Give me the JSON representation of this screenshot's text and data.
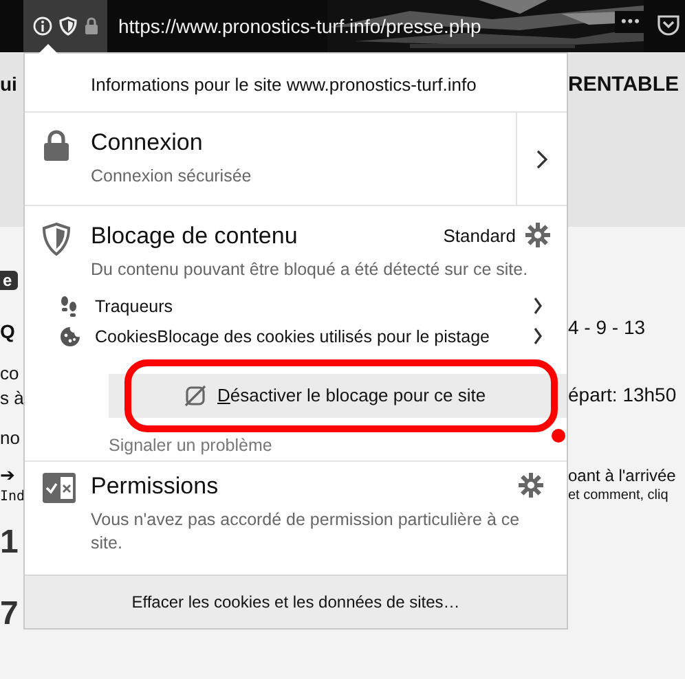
{
  "toolbar": {
    "url": "https://www.pronostics-turf.info/presse.php",
    "more_button": "•••"
  },
  "page_left": [
    {
      "kind": "bold",
      "text": "ui"
    },
    {
      "kind": "badge",
      "text": "e"
    },
    {
      "kind": "bold",
      "text": "Q"
    },
    {
      "kind": "plain",
      "text": "co"
    },
    {
      "kind": "plain",
      "text": "s à"
    },
    {
      "kind": "plain",
      "text": "no"
    },
    {
      "kind": "plain",
      "text": "➔"
    },
    {
      "kind": "small",
      "text": "Ind"
    },
    {
      "kind": "large",
      "text": "1"
    },
    {
      "kind": "large",
      "text": "7"
    }
  ],
  "page_right": [
    {
      "kind": "bold",
      "text": "RENTABLE"
    },
    {
      "kind": "plain",
      "text": "4 - 9 - 13"
    },
    {
      "kind": "plain",
      "text": "épart: 13h50"
    },
    {
      "kind": "plain",
      "text": "oant à l'arrivée"
    },
    {
      "kind": "small",
      "text": "et comment, cliq"
    }
  ],
  "panel": {
    "title": "Informations pour le site www.pronostics-turf.info",
    "connection": {
      "title": "Connexion",
      "subtitle": "Connexion sécurisée"
    },
    "content_blocking": {
      "title": "Blocage de contenu",
      "mode": "Standard",
      "description": "Du contenu pouvant être bloqué a été détecté sur ce site.",
      "items": [
        {
          "kind": "trackers",
          "label": "Traqueurs"
        },
        {
          "kind": "cookies",
          "label": "CookiesBlocage des cookies utilisés pour le pistage"
        }
      ],
      "disable_button": {
        "label": "Désactiver le blocage pour ce site"
      },
      "report_link": "Signaler un problème"
    },
    "permissions": {
      "title": "Permissions",
      "description": "Vous n'avez pas accordé de permission particulière à ce site."
    },
    "footer_button": "Effacer les cookies et les données de sites…"
  }
}
